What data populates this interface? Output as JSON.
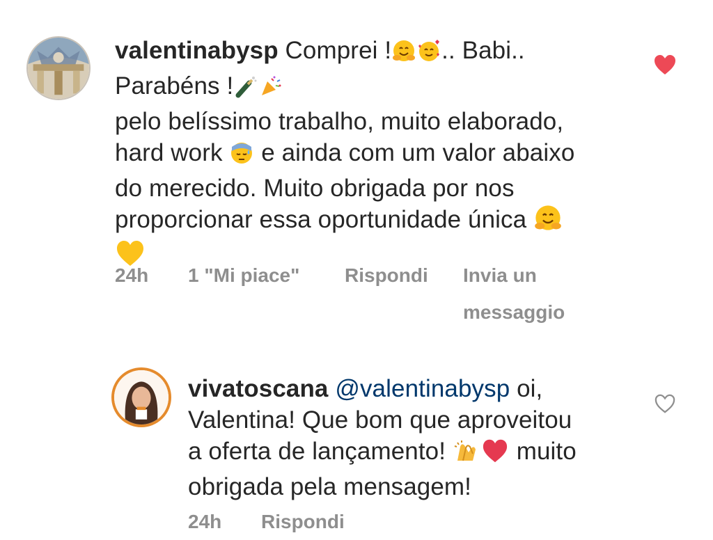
{
  "comments": [
    {
      "username": "valentinabysp",
      "text_lines": [
        [
          "Comprei !",
          ".. Babi.."
        ],
        [
          "Parabéns !"
        ],
        [
          "pelo belíssimo trabalho, muito elaborado,"
        ],
        [
          "hard work",
          " e ainda com um valor abaixo"
        ],
        [
          "do merecido. Muito obrigada por nos"
        ],
        [
          "proporcionar essa oportunidade única"
        ]
      ],
      "time": "24h",
      "likes": "1 \"Mi piace\"",
      "reply": "Rispondi",
      "send_message": [
        "Invia un",
        "messaggio"
      ],
      "liked": true
    },
    {
      "username": "vivatoscana",
      "mention": "@valentinabysp",
      "text_lines": [
        [
          " oi,"
        ],
        [
          "Valentina! Que bom que aproveitou"
        ],
        [
          "a oferta de lançamento!",
          " muito"
        ],
        [
          "obrigada pela mensagem!"
        ]
      ],
      "time": "24h",
      "reply": "Rispondi",
      "liked": false
    }
  ],
  "colors": {
    "like_active": "#ed4956",
    "meta_gray": "#8e8e8e",
    "mention_blue": "#00376b",
    "text": "#262626"
  },
  "icons": {
    "heart_filled": "heart-filled-icon",
    "heart_outline": "heart-outline-icon"
  }
}
